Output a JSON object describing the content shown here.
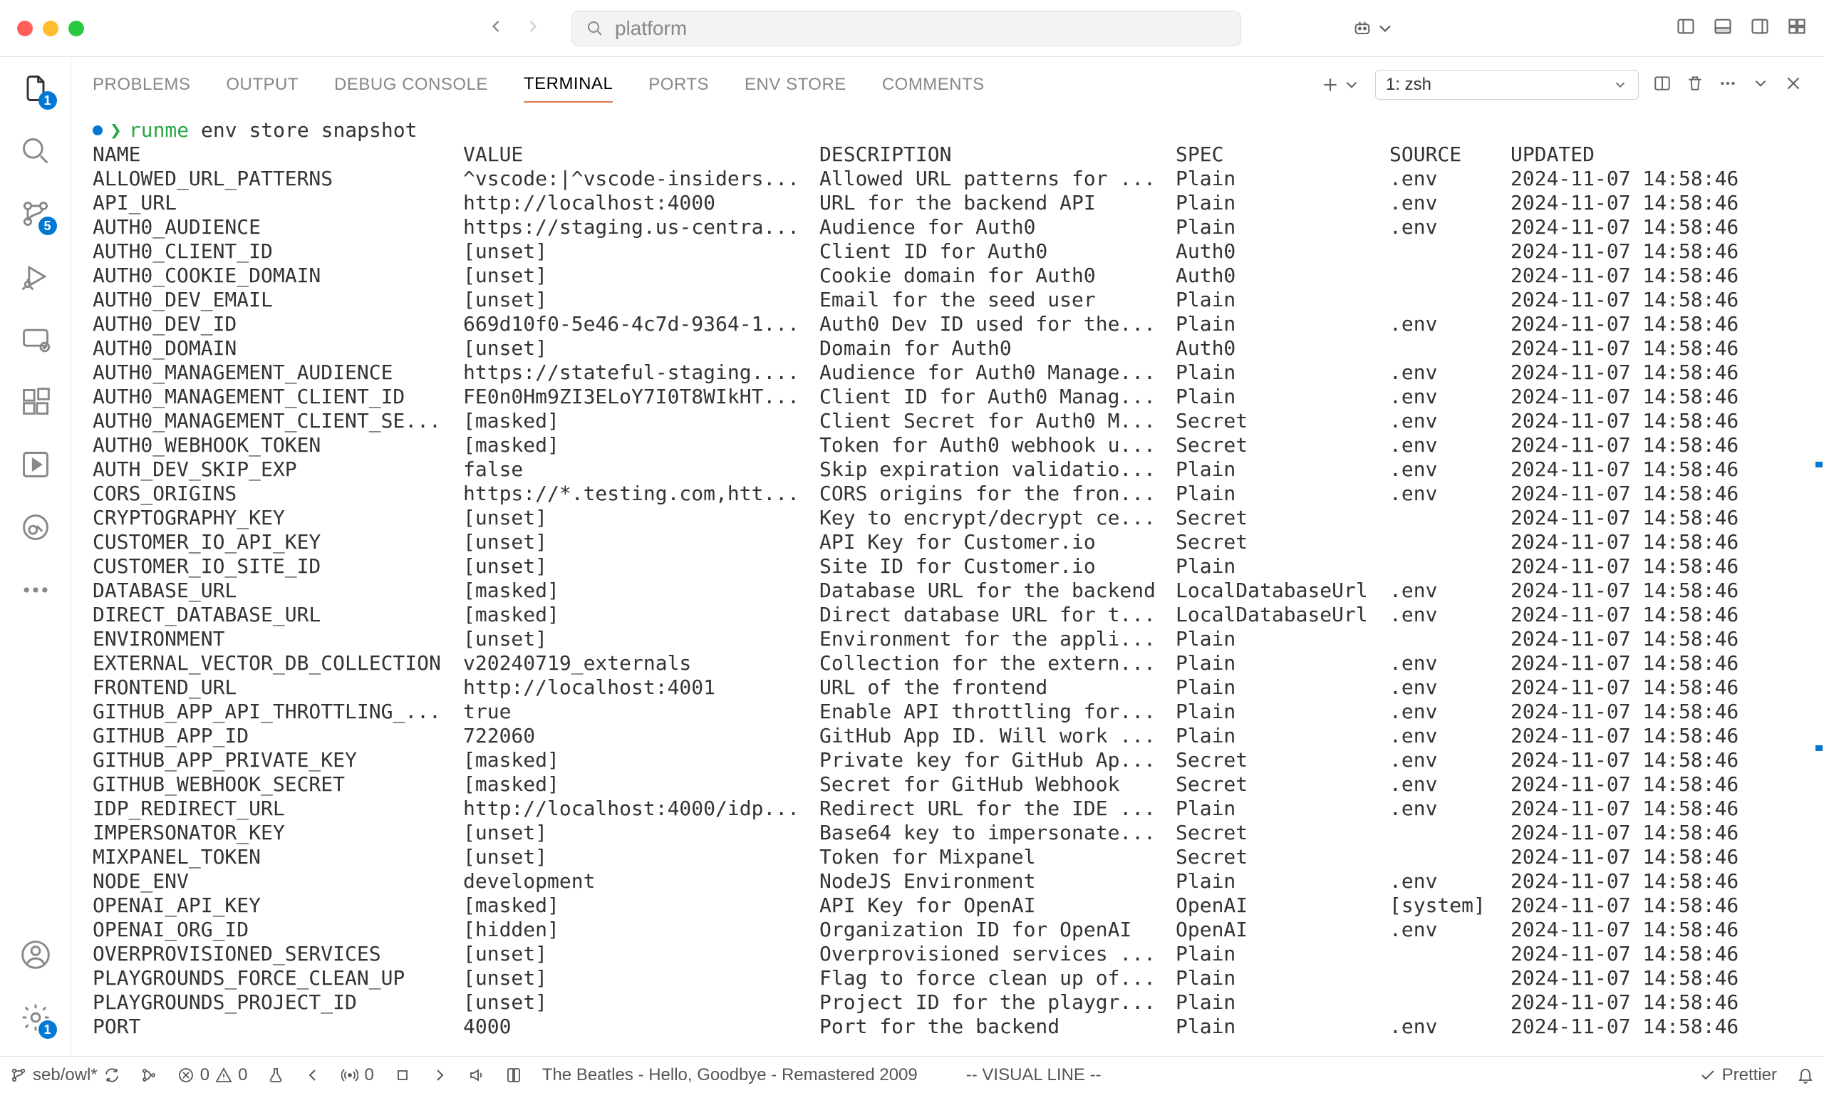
{
  "titlebar": {
    "search_text": "platform"
  },
  "activity_badges": {
    "explorer": "1",
    "scm": "5",
    "settings": "1"
  },
  "panel_tabs": [
    "PROBLEMS",
    "OUTPUT",
    "DEBUG CONSOLE",
    "TERMINAL",
    "PORTS",
    "ENV STORE",
    "COMMENTS"
  ],
  "terminal_selector": "1: zsh",
  "terminal": {
    "command_green": "runme",
    "command_rest": " env store snapshot",
    "header": {
      "name": "NAME",
      "value": "VALUE",
      "desc": "DESCRIPTION",
      "spec": "SPEC",
      "source": "SOURCE",
      "updated": "UPDATED"
    },
    "rows": [
      {
        "name": "ALLOWED_URL_PATTERNS",
        "value": "^vscode:|^vscode-insiders...",
        "desc": "Allowed URL patterns for ...",
        "spec": "Plain",
        "source": ".env",
        "updated": "2024-11-07 14:58:46"
      },
      {
        "name": "API_URL",
        "value": "http://localhost:4000",
        "desc": "URL for the backend API",
        "spec": "Plain",
        "source": ".env",
        "updated": "2024-11-07 14:58:46"
      },
      {
        "name": "AUTH0_AUDIENCE",
        "value": "https://staging.us-centra...",
        "desc": "Audience for Auth0",
        "spec": "Plain",
        "source": ".env",
        "updated": "2024-11-07 14:58:46"
      },
      {
        "name": "AUTH0_CLIENT_ID",
        "value": "[unset]",
        "desc": "Client ID for Auth0",
        "spec": "Auth0",
        "source": "",
        "updated": "2024-11-07 14:58:46"
      },
      {
        "name": "AUTH0_COOKIE_DOMAIN",
        "value": "[unset]",
        "desc": "Cookie domain for Auth0",
        "spec": "Auth0",
        "source": "",
        "updated": "2024-11-07 14:58:46"
      },
      {
        "name": "AUTH0_DEV_EMAIL",
        "value": "[unset]",
        "desc": "Email for the seed user",
        "spec": "Plain",
        "source": "",
        "updated": "2024-11-07 14:58:46"
      },
      {
        "name": "AUTH0_DEV_ID",
        "value": "669d10f0-5e46-4c7d-9364-1...",
        "desc": "Auth0 Dev ID used for the...",
        "spec": "Plain",
        "source": ".env",
        "updated": "2024-11-07 14:58:46"
      },
      {
        "name": "AUTH0_DOMAIN",
        "value": "[unset]",
        "desc": "Domain for Auth0",
        "spec": "Auth0",
        "source": "",
        "updated": "2024-11-07 14:58:46"
      },
      {
        "name": "AUTH0_MANAGEMENT_AUDIENCE",
        "value": "https://stateful-staging....",
        "desc": "Audience for Auth0 Manage...",
        "spec": "Plain",
        "source": ".env",
        "updated": "2024-11-07 14:58:46"
      },
      {
        "name": "AUTH0_MANAGEMENT_CLIENT_ID",
        "value": "FE0n0Hm9ZI3ELoY7I0T8WIkHT...",
        "desc": "Client ID for Auth0 Manag...",
        "spec": "Plain",
        "source": ".env",
        "updated": "2024-11-07 14:58:46"
      },
      {
        "name": "AUTH0_MANAGEMENT_CLIENT_SE...",
        "value": "[masked]",
        "desc": "Client Secret for Auth0 M...",
        "spec": "Secret",
        "source": ".env",
        "updated": "2024-11-07 14:58:46"
      },
      {
        "name": "AUTH0_WEBHOOK_TOKEN",
        "value": "[masked]",
        "desc": "Token for Auth0 webhook u...",
        "spec": "Secret",
        "source": ".env",
        "updated": "2024-11-07 14:58:46"
      },
      {
        "name": "AUTH_DEV_SKIP_EXP",
        "value": "false",
        "desc": "Skip expiration validatio...",
        "spec": "Plain",
        "source": ".env",
        "updated": "2024-11-07 14:58:46"
      },
      {
        "name": "CORS_ORIGINS",
        "value": "https://*.testing.com,htt...",
        "desc": "CORS origins for the fron...",
        "spec": "Plain",
        "source": ".env",
        "updated": "2024-11-07 14:58:46"
      },
      {
        "name": "CRYPTOGRAPHY_KEY",
        "value": "[unset]",
        "desc": "Key to encrypt/decrypt ce...",
        "spec": "Secret",
        "source": "",
        "updated": "2024-11-07 14:58:46"
      },
      {
        "name": "CUSTOMER_IO_API_KEY",
        "value": "[unset]",
        "desc": "API Key for Customer.io",
        "spec": "Secret",
        "source": "",
        "updated": "2024-11-07 14:58:46"
      },
      {
        "name": "CUSTOMER_IO_SITE_ID",
        "value": "[unset]",
        "desc": "Site ID for Customer.io",
        "spec": "Plain",
        "source": "",
        "updated": "2024-11-07 14:58:46"
      },
      {
        "name": "DATABASE_URL",
        "value": "[masked]",
        "desc": "Database URL for the backend",
        "spec": "LocalDatabaseUrl",
        "source": ".env",
        "updated": "2024-11-07 14:58:46"
      },
      {
        "name": "DIRECT_DATABASE_URL",
        "value": "[masked]",
        "desc": "Direct database URL for t...",
        "spec": "LocalDatabaseUrl",
        "source": ".env",
        "updated": "2024-11-07 14:58:46"
      },
      {
        "name": "ENVIRONMENT",
        "value": "[unset]",
        "desc": "Environment for the appli...",
        "spec": "Plain",
        "source": "",
        "updated": "2024-11-07 14:58:46"
      },
      {
        "name": "EXTERNAL_VECTOR_DB_COLLECTION",
        "value": "v20240719_externals",
        "desc": "Collection for the extern...",
        "spec": "Plain",
        "source": ".env",
        "updated": "2024-11-07 14:58:46"
      },
      {
        "name": "FRONTEND_URL",
        "value": "http://localhost:4001",
        "desc": "URL of the frontend",
        "spec": "Plain",
        "source": ".env",
        "updated": "2024-11-07 14:58:46"
      },
      {
        "name": "GITHUB_APP_API_THROTTLING_...",
        "value": "true",
        "desc": "Enable API throttling for...",
        "spec": "Plain",
        "source": ".env",
        "updated": "2024-11-07 14:58:46"
      },
      {
        "name": "GITHUB_APP_ID",
        "value": "722060",
        "desc": "GitHub App ID. Will work ...",
        "spec": "Plain",
        "source": ".env",
        "updated": "2024-11-07 14:58:46"
      },
      {
        "name": "GITHUB_APP_PRIVATE_KEY",
        "value": "[masked]",
        "desc": "Private key for GitHub Ap...",
        "spec": "Secret",
        "source": ".env",
        "updated": "2024-11-07 14:58:46"
      },
      {
        "name": "GITHUB_WEBHOOK_SECRET",
        "value": "[masked]",
        "desc": "Secret for GitHub Webhook",
        "spec": "Secret",
        "source": ".env",
        "updated": "2024-11-07 14:58:46"
      },
      {
        "name": "IDP_REDIRECT_URL",
        "value": "http://localhost:4000/idp...",
        "desc": "Redirect URL for the IDE ...",
        "spec": "Plain",
        "source": ".env",
        "updated": "2024-11-07 14:58:46"
      },
      {
        "name": "IMPERSONATOR_KEY",
        "value": "[unset]",
        "desc": "Base64 key to impersonate...",
        "spec": "Secret",
        "source": "",
        "updated": "2024-11-07 14:58:46"
      },
      {
        "name": "MIXPANEL_TOKEN",
        "value": "[unset]",
        "desc": "Token for Mixpanel",
        "spec": "Secret",
        "source": "",
        "updated": "2024-11-07 14:58:46"
      },
      {
        "name": "NODE_ENV",
        "value": "development",
        "desc": "NodeJS Environment",
        "spec": "Plain",
        "source": ".env",
        "updated": "2024-11-07 14:58:46"
      },
      {
        "name": "OPENAI_API_KEY",
        "value": "[masked]",
        "desc": "API Key for OpenAI",
        "spec": "OpenAI",
        "source": "[system]",
        "updated": "2024-11-07 14:58:46"
      },
      {
        "name": "OPENAI_ORG_ID",
        "value": "[hidden]",
        "desc": "Organization ID for OpenAI",
        "spec": "OpenAI",
        "source": ".env",
        "updated": "2024-11-07 14:58:46"
      },
      {
        "name": "OVERPROVISIONED_SERVICES",
        "value": "[unset]",
        "desc": "Overprovisioned services ...",
        "spec": "Plain",
        "source": "",
        "updated": "2024-11-07 14:58:46"
      },
      {
        "name": "PLAYGROUNDS_FORCE_CLEAN_UP",
        "value": "[unset]",
        "desc": "Flag to force clean up of...",
        "spec": "Plain",
        "source": "",
        "updated": "2024-11-07 14:58:46"
      },
      {
        "name": "PLAYGROUNDS_PROJECT_ID",
        "value": "[unset]",
        "desc": "Project ID for the playgr...",
        "spec": "Plain",
        "source": "",
        "updated": "2024-11-07 14:58:46"
      },
      {
        "name": "PORT",
        "value": "4000",
        "desc": "Port for the backend",
        "spec": "Plain",
        "source": ".env",
        "updated": "2024-11-07 14:58:46"
      }
    ]
  },
  "statusbar": {
    "branch": "seb/owl*",
    "err_count": "0",
    "warn_count": "0",
    "radio_count": "0",
    "now_playing": "The Beatles - Hello, Goodbye - Remastered 2009",
    "vim_mode": "-- VISUAL LINE --",
    "prettier": "Prettier"
  }
}
